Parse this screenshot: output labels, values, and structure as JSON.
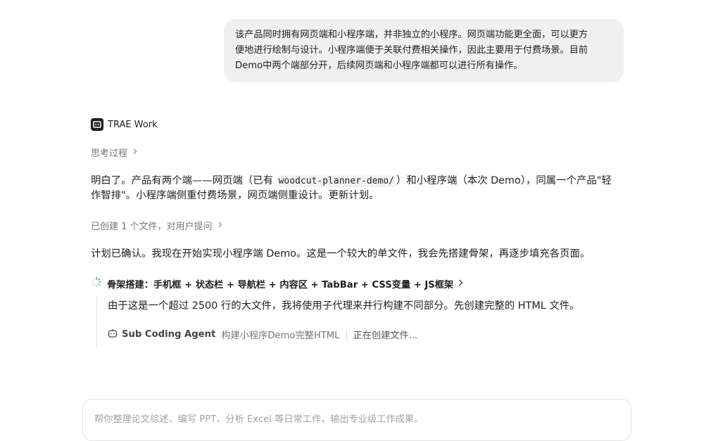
{
  "user_message": {
    "lines": [
      "该产品同时拥有网页端和小程序端，并非独立的小程序。网页端功能更全面，可以更方",
      "便地进行绘制与设计。小程序端便于关联付费相关操作，因此主要用于付费场景。目前",
      "Demo中两个端部分开，后续网页端和小程序端都可以进行所有操作。"
    ]
  },
  "agent": {
    "name": "TRAE Work",
    "icon": "trae-logo-icon"
  },
  "thinking": {
    "label": "思考过程"
  },
  "reply1": {
    "before": "明白了。产品有两个端——网页端（已有 ",
    "code": "woodcut-planner-demo/",
    "after": "）和小程序端（本次 Demo），同属一个产品\"轻作智排\"。小程序端侧重付费场景，网页端侧重设计。更新计划。"
  },
  "created": {
    "label": "已创建 1 个文件，对用户提问"
  },
  "reply2": {
    "text": "计划已确认。我现在开始实现小程序端 Demo。这是一个较大的单文件，我会先搭建骨架，再逐步填充各页面。"
  },
  "step": {
    "title": "骨架搭建：手机框 + 状态栏 + 导航栏 + 内容区 + TabBar + CSS变量 + JS框架",
    "body": "由于这是一个超过 2500 行的大文件，我将使用子代理来并行构建不同部分。先创建完整的 HTML 文件。",
    "sub_agent": {
      "name": "Sub Coding Agent",
      "task": "构建小程序Demo完整HTML",
      "status": "正在创建文件..."
    }
  },
  "input": {
    "placeholder": "帮你整理论文综述、编写 PPT、分析 Excel 等日常工作，输出专业级工作成果。",
    "value": ""
  }
}
